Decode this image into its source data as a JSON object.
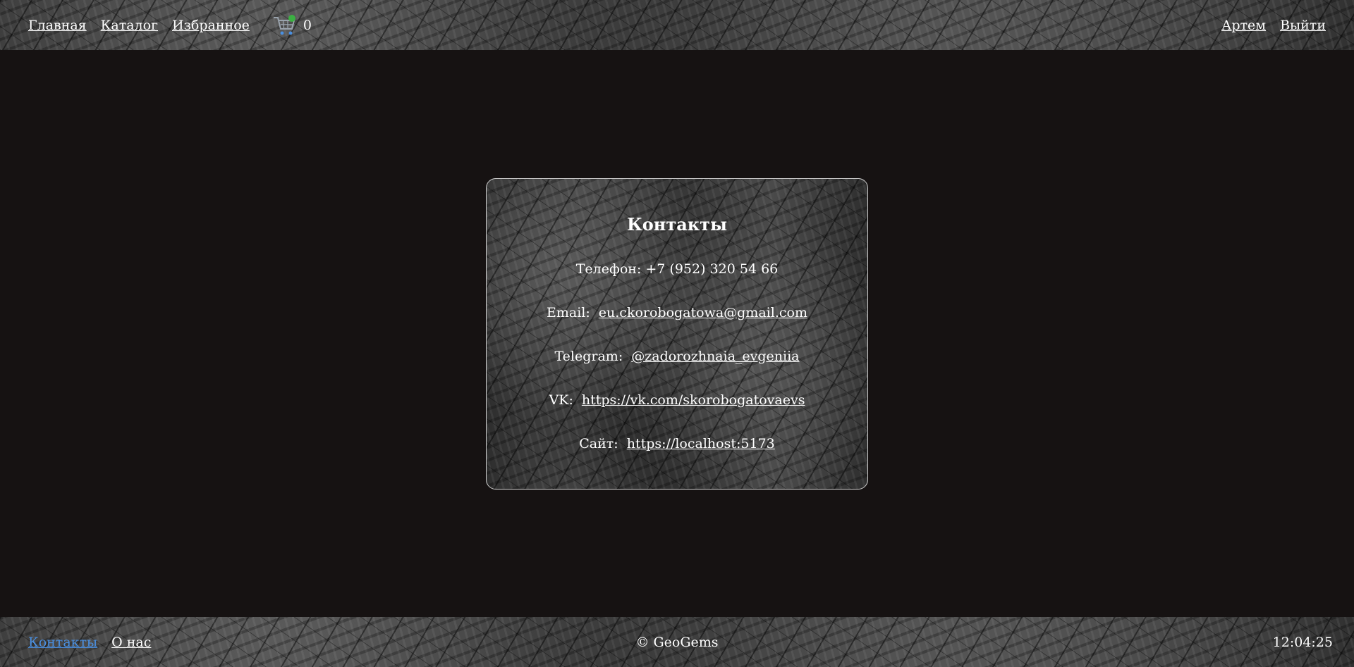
{
  "header": {
    "nav": [
      {
        "label": "Главная"
      },
      {
        "label": "Каталог"
      },
      {
        "label": "Избранное"
      }
    ],
    "cart_icon": "cart-icon",
    "cart_count": "0",
    "user_name": "Артем",
    "logout_label": "Выйти"
  },
  "contacts": {
    "title": "Контакты",
    "phone": "Телефон: +7 (952) 320 54 66",
    "email_label": "Email:",
    "email_value": "eu.ckorobogatowa@gmail.com",
    "telegram_label": "Telegram:",
    "telegram_value": "@zadorozhnaia_evgeniia",
    "vk_label": "VK:",
    "vk_value": "https://vk.com/skorobogatovaevs",
    "site_label": "Сайт:",
    "site_value": "https://localhost:5173"
  },
  "footer": {
    "links": [
      {
        "label": "Контакты",
        "active": true
      },
      {
        "label": "О нас",
        "active": false
      }
    ],
    "copyright": "© GeoGems",
    "time": "12:04:25"
  },
  "colors": {
    "background": "#161212",
    "active_link": "#4a90e2",
    "cart_badge": "#3cb043"
  }
}
